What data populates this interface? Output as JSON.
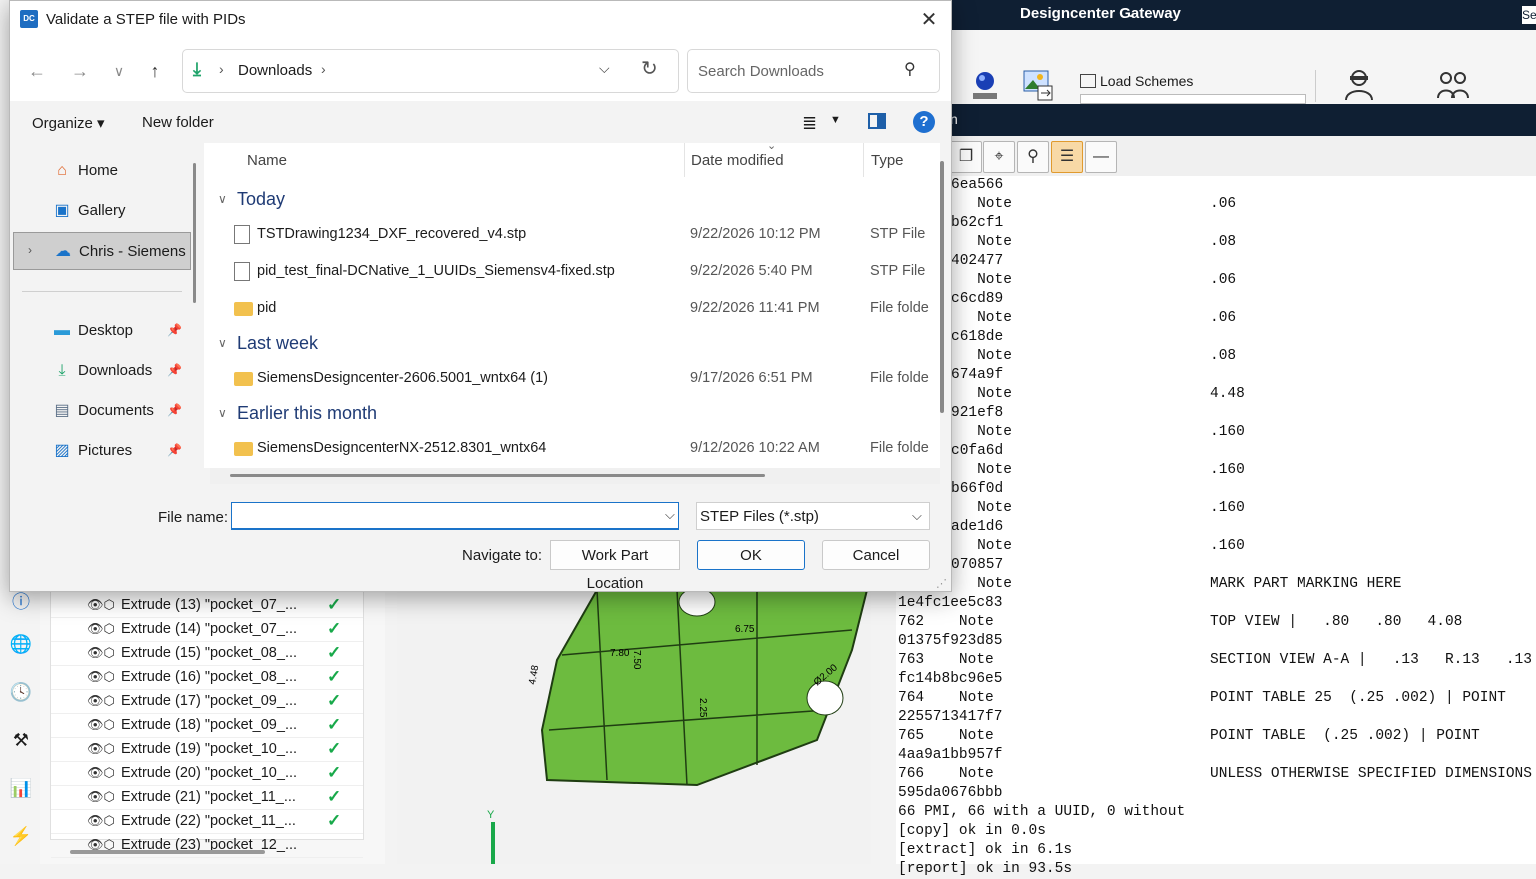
{
  "dialog": {
    "title": "Validate a STEP file with PIDs",
    "app_icon": "DC",
    "close_glyph": "✕",
    "nav": {
      "back": "←",
      "forward": "→",
      "recent": "∨",
      "up": "↑"
    },
    "address": {
      "icon": "download-icon",
      "path": "Downloads",
      "separator": "›"
    },
    "search": {
      "placeholder": "Search Downloads"
    },
    "toolbar": {
      "organize": "Organize ▾",
      "new_folder": "New folder"
    },
    "nav_pane": [
      {
        "label": "Home",
        "icon": "home-icon"
      },
      {
        "label": "Gallery",
        "icon": "gallery-icon"
      },
      {
        "label": "Chris - Siemens",
        "icon": "cloud-icon"
      },
      {
        "label": "Desktop",
        "icon": "desktop-icon"
      },
      {
        "label": "Downloads",
        "icon": "download-icon"
      },
      {
        "label": "Documents",
        "icon": "documents-icon"
      },
      {
        "label": "Pictures",
        "icon": "pictures-icon"
      }
    ],
    "columns": {
      "name": "Name",
      "date": "Date modified",
      "type": "Type"
    },
    "groups": [
      {
        "name": "Today"
      },
      {
        "name": "Last week"
      },
      {
        "name": "Earlier this month"
      }
    ],
    "files": [
      {
        "name": "TSTDrawing1234_DXF_recovered_v4.stp",
        "date": "9/22/2026 10:12 PM",
        "type": "STP File",
        "kind": "file"
      },
      {
        "name": "pid_test_final-DCNative_1_UUIDs_Siemensv4-fixed.stp",
        "date": "9/22/2026 5:40 PM",
        "type": "STP File",
        "kind": "file"
      },
      {
        "name": "pid",
        "date": "9/22/2026 11:41 PM",
        "type": "File folde",
        "kind": "folder"
      },
      {
        "name": "SiemensDesigncenter-2606.5001_wntx64 (1)",
        "date": "9/17/2026 6:51 PM",
        "type": "File folde",
        "kind": "folder"
      },
      {
        "name": "SiemensDesigncenterNX-2512.8301_wntx64",
        "date": "9/12/2026 10:22 AM",
        "type": "File folde",
        "kind": "folder"
      }
    ],
    "file_name_label": "File name:",
    "file_name_value": "",
    "filter": "STEP Files (*.stp)",
    "navigate_to_label": "Navigate to:",
    "work_part_button": "Work Part Location",
    "ok": "OK",
    "cancel": "Cancel"
  },
  "app": {
    "title": "Designcenter  Gateway",
    "title_suffix": "Se",
    "load_schemes": "Load Schemes",
    "panel_title_fragment": "n",
    "console_lines": [
      {
        "a": "6ea566",
        "b": ""
      },
      {
        "a": "   Note",
        "b": ".06"
      },
      {
        "a": "b62cf1",
        "b": ""
      },
      {
        "a": "   Note",
        "b": ".08"
      },
      {
        "a": "402477",
        "b": ""
      },
      {
        "a": "   Note",
        "b": ".06"
      },
      {
        "a": "c6cd89",
        "b": ""
      },
      {
        "a": "   Note",
        "b": ".06"
      },
      {
        "a": "c618de",
        "b": ""
      },
      {
        "a": "   Note",
        "b": ".08"
      },
      {
        "a": "674a9f",
        "b": ""
      },
      {
        "a": "   Note",
        "b": "4.48"
      },
      {
        "a": "921ef8",
        "b": ""
      },
      {
        "a": "   Note",
        "b": ".160"
      },
      {
        "a": "c0fa6d",
        "b": ""
      },
      {
        "a": "   Note",
        "b": ".160"
      },
      {
        "a": "b66f0d",
        "b": ""
      },
      {
        "a": "   Note",
        "b": ".160"
      },
      {
        "a": "ade1d6",
        "b": ""
      },
      {
        "a": "   Note",
        "b": ".160"
      },
      {
        "a": "070857",
        "b": ""
      },
      {
        "a": "   Note",
        "b": "MARK PART MARKING HERE"
      }
    ],
    "console_full": [
      {
        "a": "1e4fc1ee5c83",
        "b": ""
      },
      {
        "a": "762    Note",
        "b": "TOP VIEW |   .80   .80   4.08"
      },
      {
        "a": "01375f923d85",
        "b": ""
      },
      {
        "a": "763    Note",
        "b": "SECTION VIEW A-A |   .13   R.13   .13"
      },
      {
        "a": "fc14b8bc96e5",
        "b": ""
      },
      {
        "a": "764    Note",
        "b": "POINT TABLE 25  (.25 .002) | POINT"
      },
      {
        "a": "2255713417f7",
        "b": ""
      },
      {
        "a": "765    Note",
        "b": "POINT TABLE  (.25 .002) | POINT"
      },
      {
        "a": "4aa9a1bb957f",
        "b": ""
      },
      {
        "a": "766    Note",
        "b": "UNLESS OTHERWISE SPECIFIED DIMENSIONS"
      },
      {
        "a": "595da0676bbb",
        "b": ""
      },
      {
        "a": "66 PMI, 66 with a UUID, 0 without",
        "b": ""
      },
      {
        "a": "[copy] ok in 0.0s",
        "b": ""
      },
      {
        "a": "[extract] ok in 6.1s",
        "b": ""
      },
      {
        "a": "[report] ok in 93.5s",
        "b": ""
      }
    ],
    "tree_rows": [
      "Extrude (13) \"pocket_07_...",
      "Extrude (14) \"pocket_07_...",
      "Extrude (15) \"pocket_08_...",
      "Extrude (16) \"pocket_08_...",
      "Extrude (17) \"pocket_09_...",
      "Extrude (18) \"pocket_09_...",
      "Extrude (19) \"pocket_10_...",
      "Extrude (20) \"pocket_10_...",
      "Extrude (21) \"pocket_11_...",
      "Extrude (22) \"pocket_11_...",
      "Extrude (23) \"pocket_12_..."
    ],
    "model_labels": [
      "6.75",
      "7.80",
      "7.50",
      "4.48",
      "2.25",
      "Ø2.00",
      "Y"
    ],
    "colors": {
      "model_green": "#6dbb3f",
      "accent": "#1a73c9",
      "titlebar": "#0f1f33"
    }
  }
}
